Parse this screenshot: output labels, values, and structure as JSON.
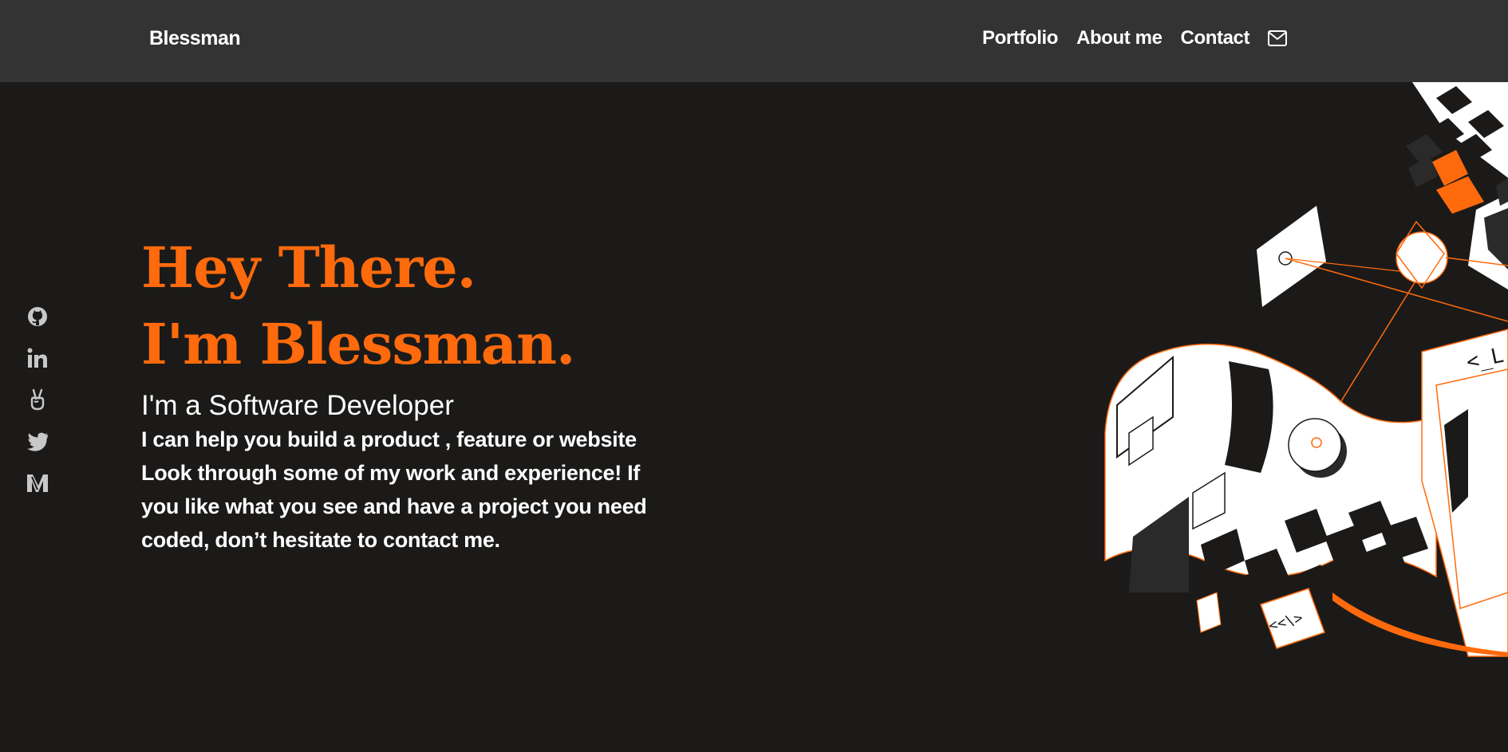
{
  "header": {
    "brand": "Blessman",
    "nav": [
      "Portfolio",
      "About me",
      "Contact"
    ],
    "mail_icon": "mail-icon"
  },
  "social": {
    "icons": [
      "github-icon",
      "linkedin-icon",
      "angellist-icon",
      "twitter-icon",
      "medium-icon"
    ]
  },
  "hero": {
    "line1": "Hey There.",
    "line2": "I'm Blessman.",
    "subtitle": "I'm a Software Developer",
    "bio": "I can help you build a product , feature or website Look through some of my work and experience! If you like what you see and have a project you need coded, don’t hesitate to contact me."
  },
  "illustration": {
    "code_tag_1": "<_L",
    "code_tag_2": "<<\\>"
  },
  "colors": {
    "accent": "#ff6a0c",
    "background": "#1b1a19",
    "navbar": "#333333",
    "text": "#ffffff"
  }
}
